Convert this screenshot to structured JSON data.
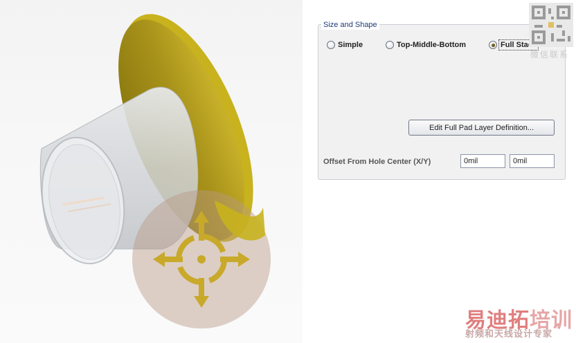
{
  "viewport": {
    "icons": [
      "pad-3d-model-icon",
      "move-crosshair-icon"
    ],
    "colors": {
      "pad_gold": "#c8b21e",
      "pad_dark": "#8e7d12",
      "barrel": "#d9dcdf",
      "ring": "#b89a86"
    }
  },
  "size_shape": {
    "title": "Size and Shape",
    "options": [
      {
        "label": "Simple",
        "checked": false
      },
      {
        "label": "Top-Middle-Bottom",
        "checked": false
      },
      {
        "label": "Full Stack",
        "checked": true
      }
    ],
    "edit_button": "Edit Full Pad Layer Definition...",
    "offset_label": "Offset From Hole Center (X/Y)",
    "offset_x": "0mil",
    "offset_y": "0mil"
  },
  "watermark": {
    "follow": "微信联系",
    "brand_a": "易迪拓",
    "brand_b": "培训",
    "slogan": "射频和天线设计专家"
  }
}
